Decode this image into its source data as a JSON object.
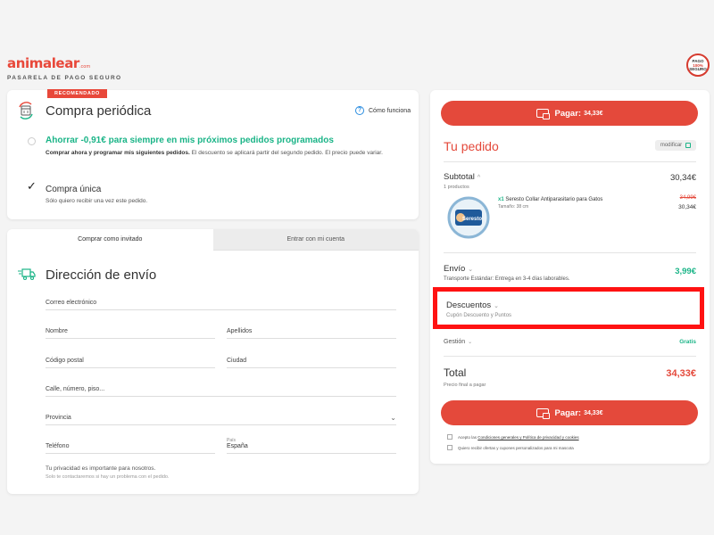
{
  "brand": {
    "logo_main": "animalear",
    "logo_suffix": ".com",
    "tagline": "PASARELA DE PAGO SEGURO",
    "seal_line1": "PAGO",
    "seal_line2": "100%",
    "seal_line3": "SEGURO",
    "color": "#e8483a"
  },
  "periodic": {
    "badge": "RECOMENDADO",
    "title": "Compra periódica",
    "how_link": "Cómo funciona",
    "save_title": "Ahorrar -0,91€ para siempre en mis próximos pedidos programados",
    "save_desc_bold": "Comprar ahora y programar mis siguientes pedidos.",
    "save_desc_rest": " El descuento se aplicará partir del segundo pedido. El precio puede variar.",
    "once_title": "Compra única",
    "once_desc": "Sólo quiero recibir una vez este pedido.",
    "selected": "Compra única"
  },
  "address": {
    "tabs": [
      "Comprar como invitado",
      "Entrar con mi cuenta"
    ],
    "active_tab": "Comprar como invitado",
    "title": "Dirección de envío",
    "fields": {
      "email": "Correo electrónico",
      "name": "Nombre",
      "surname": "Apellidos",
      "postal": "Código postal",
      "city": "Ciudad",
      "street": "Calle, número, piso...",
      "province": "Provincia",
      "phone": "Teléfono",
      "country_small": "País",
      "country_value": "España"
    },
    "privacy_1": "Tu privacidad es importante para nosotros.",
    "privacy_2": "Solo te contactaremos si hay un problema con el pedido."
  },
  "order": {
    "pay_label": "Pagar:",
    "pay_amount": "34,33€",
    "title": "Tu pedido",
    "modify": "modificar",
    "subtotal_label": "Subtotal",
    "subtotal_count": "1 productos",
    "subtotal_value": "30,34€",
    "product": {
      "qty": "x1",
      "name": "Seresto Collar Antiparasitario para Gatos",
      "size": "Tamaño: 38 cm",
      "old_price": "34,99€",
      "price": "30,34€",
      "img_text": "Seresto"
    },
    "shipping_label": "Envío",
    "shipping_desc": "Transporte Estándar: Entrega en 3-4 días laborables.",
    "shipping_price": "3,99€",
    "discounts_label": "Descuentos",
    "discounts_desc": "Cupón Descuento y Puntos",
    "management_label": "Gestión",
    "management_price": "Gratis",
    "total_label": "Total",
    "total_desc": "Precio final a pagar",
    "total_value": "34,33€",
    "consent_pre": "Acepto las ",
    "consent_link": "Condiciones generales y Política de privacidad y cookies",
    "offers": "Quiero recibir ofertas y cupones personalizados para mi mascota"
  },
  "colors": {
    "accent": "#e4493b",
    "green": "#1ab487",
    "highlight": "#ff1212"
  }
}
